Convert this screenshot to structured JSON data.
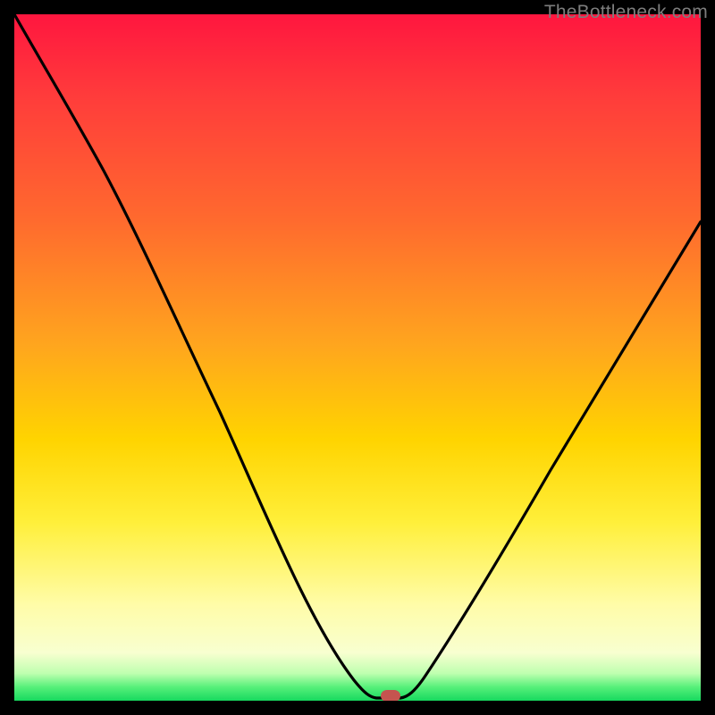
{
  "watermark": "TheBottleneck.com",
  "chart_data": {
    "type": "line",
    "title": "",
    "xlabel": "",
    "ylabel": "",
    "x_range": [
      0,
      100
    ],
    "y_range": [
      0,
      100
    ],
    "series": [
      {
        "name": "bottleneck-curve",
        "x": [
          0,
          6,
          12,
          18,
          24,
          30,
          36,
          42,
          47,
          50,
          53,
          56,
          60,
          66,
          74,
          82,
          90,
          100
        ],
        "y": [
          100,
          90,
          80,
          68,
          56,
          44,
          33,
          22,
          12,
          4,
          0,
          0,
          4,
          12,
          24,
          38,
          52,
          70
        ]
      }
    ],
    "marker": {
      "name": "optimal-point",
      "x": 54.5,
      "y": 0.5,
      "color": "#c5544f"
    },
    "gradient_stops": [
      {
        "pos": 0,
        "color": "#ff163f"
      },
      {
        "pos": 12,
        "color": "#ff3c3b"
      },
      {
        "pos": 30,
        "color": "#ff6a2e"
      },
      {
        "pos": 48,
        "color": "#ffa51e"
      },
      {
        "pos": 62,
        "color": "#ffd400"
      },
      {
        "pos": 74,
        "color": "#ffef3a"
      },
      {
        "pos": 86,
        "color": "#fffca8"
      },
      {
        "pos": 93,
        "color": "#f8ffd0"
      },
      {
        "pos": 96,
        "color": "#bfffb0"
      },
      {
        "pos": 98,
        "color": "#57f07a"
      },
      {
        "pos": 100,
        "color": "#17d95f"
      }
    ]
  }
}
